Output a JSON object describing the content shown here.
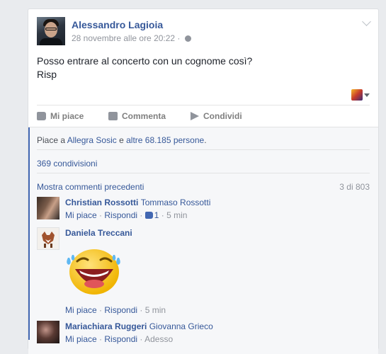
{
  "post": {
    "author": "Alessandro Lagioia",
    "timestamp": "28 novembre alle ore 20:22 ·",
    "text_line1": "Posso entrare al concerto con un cognome così?",
    "text_line2": "Risp"
  },
  "actions": {
    "like": "Mi piace",
    "comment": "Commenta",
    "share": "Condividi"
  },
  "likes": {
    "prefix": "Piace a",
    "friend": "Allegra Sosic",
    "conj": "e",
    "others": "altre 68.185 persone",
    "suffix": "."
  },
  "shares": "369 condivisioni",
  "more_comments": {
    "label": "Mostra commenti precedenti",
    "counter": "3 di 803"
  },
  "comments": [
    {
      "author": "Christian Rossotti",
      "tag": "Tommaso Rossotti",
      "like": "Mi piace",
      "reply": "Rispondi",
      "like_count": "1",
      "time": "5 min"
    },
    {
      "author": "Daniela Treccani",
      "sticker": "laughing-tears-sticker",
      "like": "Mi piace",
      "reply": "Rispondi",
      "time": "5 min"
    },
    {
      "author": "Mariachiara Ruggeri",
      "tag": "Giovanna Grieco",
      "like": "Mi piace",
      "reply": "Rispondi",
      "time": "Adesso"
    }
  ],
  "colors": {
    "link": "#365899",
    "accent": "#4267b2",
    "muted": "#90949c",
    "background": "#e9ebee"
  }
}
